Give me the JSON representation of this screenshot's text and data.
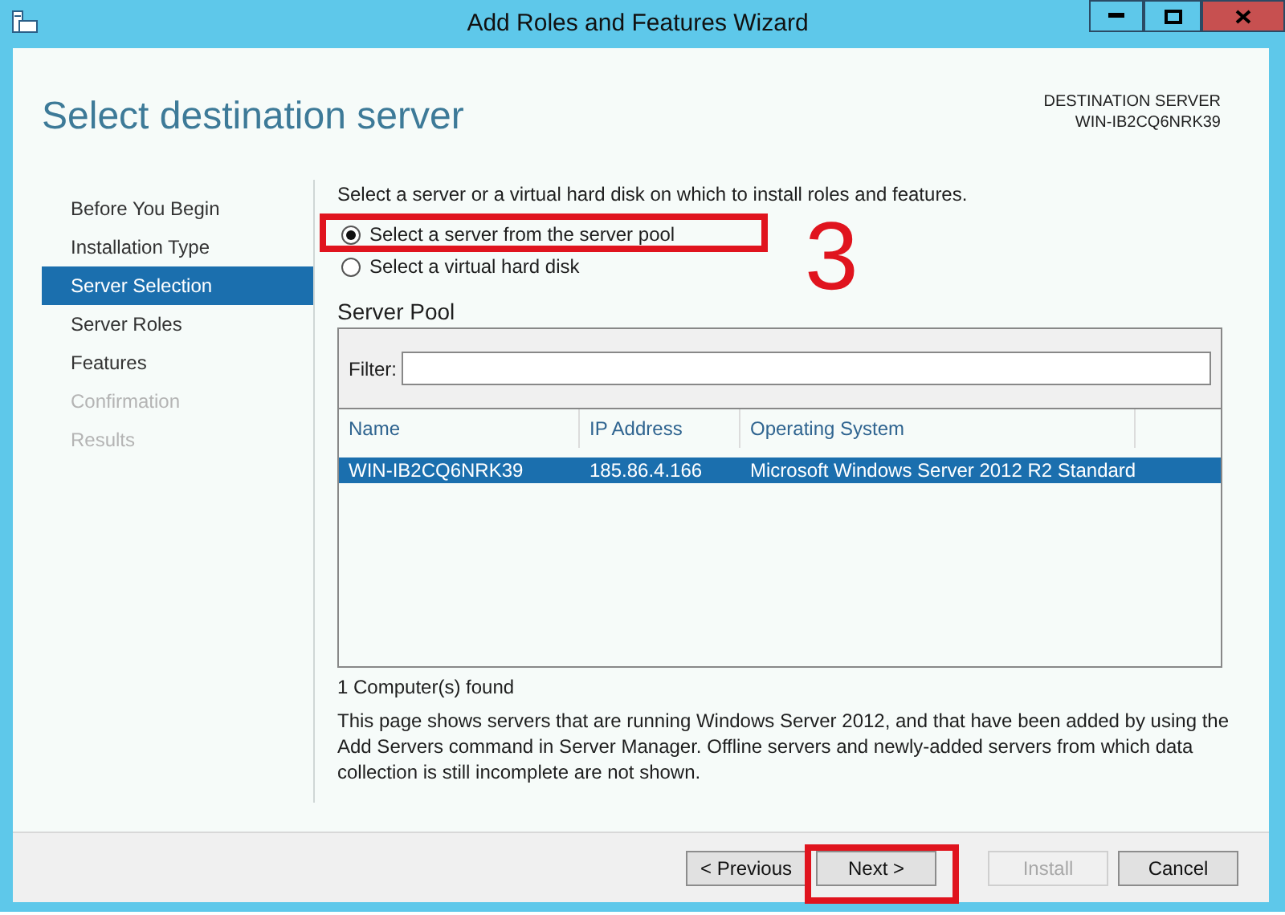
{
  "window": {
    "title": "Add Roles and Features Wizard"
  },
  "page_title": "Select destination server",
  "destination": {
    "label": "DESTINATION SERVER",
    "server": "WIN-IB2CQ6NRK39"
  },
  "steps": [
    {
      "label": "Before You Begin",
      "selected": false,
      "disabled": false
    },
    {
      "label": "Installation Type",
      "selected": false,
      "disabled": false
    },
    {
      "label": "Server Selection",
      "selected": true,
      "disabled": false
    },
    {
      "label": "Server Roles",
      "selected": false,
      "disabled": false
    },
    {
      "label": "Features",
      "selected": false,
      "disabled": false
    },
    {
      "label": "Confirmation",
      "selected": false,
      "disabled": true
    },
    {
      "label": "Results",
      "selected": false,
      "disabled": true
    }
  ],
  "intro": "Select a server or a virtual hard disk on which to install roles and features.",
  "options": [
    {
      "label": "Select a server from the server pool",
      "selected": true,
      "highlighted": true
    },
    {
      "label": "Select a virtual hard disk",
      "selected": false,
      "highlighted": false
    }
  ],
  "step_number": "3",
  "server_pool": {
    "title": "Server Pool",
    "filter_label": "Filter:",
    "columns": [
      "Name",
      "IP Address",
      "Operating System"
    ],
    "rows": [
      {
        "cells": [
          "WIN-IB2CQ6NRK39",
          "185.86.4.166",
          "Microsoft Windows Server 2012 R2 Standard"
        ],
        "selected": true
      }
    ]
  },
  "found": "1 Computer(s) found",
  "note": "This page shows servers that are running Windows Server 2012, and that have been added by using the Add Servers command in Server Manager. Offline servers and newly-added servers from which data collection is still incomplete are not shown.",
  "buttons": [
    {
      "label": "< Previous",
      "disabled": false,
      "highlighted": false
    },
    {
      "label": "Next >",
      "disabled": false,
      "highlighted": true
    },
    {
      "label": "Install",
      "disabled": true,
      "highlighted": false
    },
    {
      "label": "Cancel",
      "disabled": false,
      "highlighted": false
    }
  ]
}
